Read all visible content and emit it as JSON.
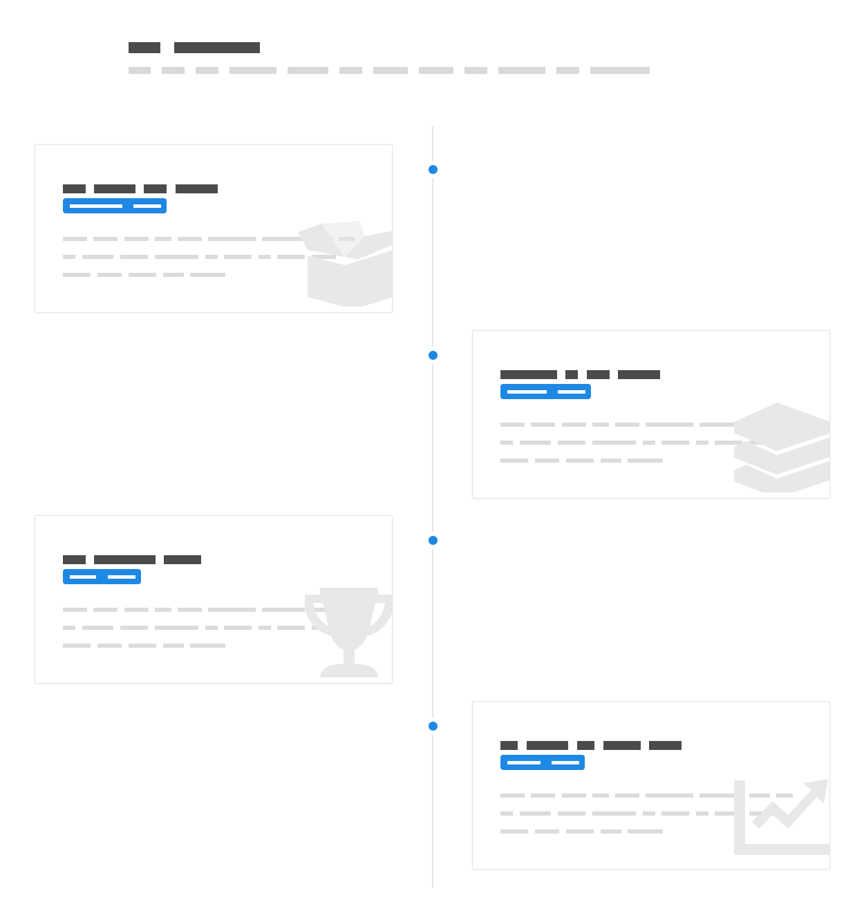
{
  "header": {
    "title": "",
    "subtitle": ""
  },
  "timeline": {
    "items": [
      {
        "side": "left",
        "title": "",
        "tag": "",
        "description": "",
        "icon": "open-box-icon"
      },
      {
        "side": "right",
        "title": "",
        "tag": "",
        "description": "",
        "icon": "layers-icon"
      },
      {
        "side": "left",
        "title": "",
        "tag": "",
        "description": "",
        "icon": "trophy-icon"
      },
      {
        "side": "right",
        "title": "",
        "tag": "",
        "description": "",
        "icon": "line-chart-icon"
      }
    ]
  },
  "colors": {
    "accent": "#1e88e5",
    "heading": "#4b4b4b",
    "placeholder": "#d9d9d9",
    "spine": "#e6e6e6",
    "icon_watermark": "#e8e8e8"
  }
}
